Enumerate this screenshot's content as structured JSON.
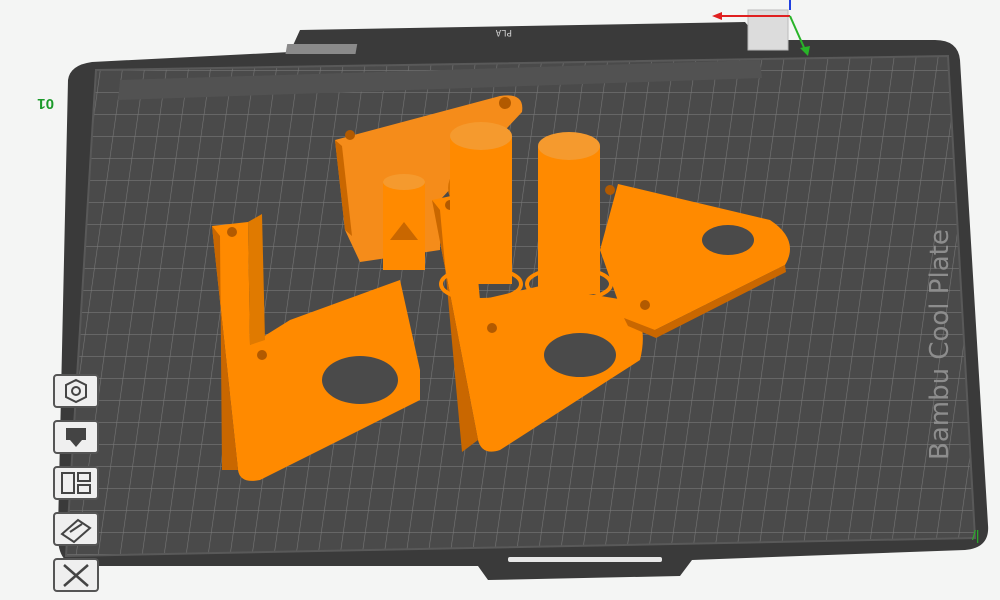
{
  "plate": {
    "name": "Bambu Cool Plate",
    "plate_number": "01",
    "filament_label": "PLA"
  },
  "colors": {
    "background": "#f4f5f4",
    "plate": "#4a4a4a",
    "plate_outer": "#3c3c3c",
    "grid_line": "#7d7d7d",
    "model_face": "#ff8a00",
    "model_top": "#f59a2e",
    "model_shadow": "#c96700",
    "axis_x": "#e02020",
    "axis_y": "#28b428",
    "axis_z": "#2040e0"
  },
  "toolbar": {
    "items": [
      {
        "name": "auto-orient",
        "icon": "hexagon-nut-icon"
      },
      {
        "name": "arrange",
        "icon": "extruder-icon"
      },
      {
        "name": "split",
        "icon": "layout-blocks-icon"
      },
      {
        "name": "plate-settings",
        "icon": "plate-edit-icon"
      },
      {
        "name": "delete-plate",
        "icon": "close-x-icon"
      }
    ]
  },
  "models": [
    {
      "name": "top-bracket-part"
    },
    {
      "name": "left-l-bracket-part"
    },
    {
      "name": "center-l-bracket-part"
    },
    {
      "name": "right-triangle-plate-part"
    },
    {
      "name": "small-cone-post-part"
    },
    {
      "name": "cylinder-post-left-part"
    },
    {
      "name": "cylinder-post-right-part"
    }
  ]
}
